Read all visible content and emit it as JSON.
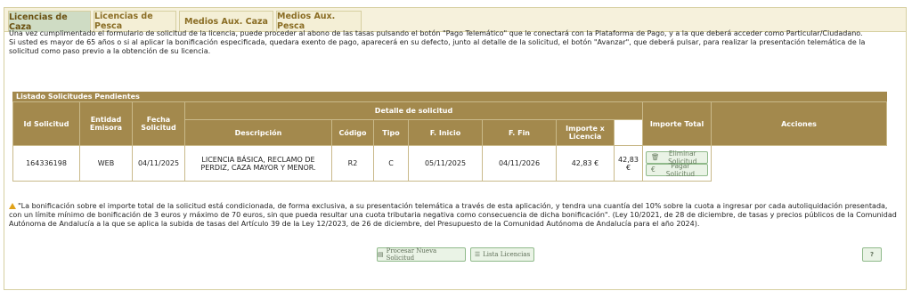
{
  "tabs": [
    {
      "label": "Licencias de Caza",
      "active": true
    },
    {
      "label": "Licencias de Pesca",
      "active": false
    },
    {
      "label": "Medios Aux. Caza",
      "active": false
    },
    {
      "label": "Medios Aux. Pesca",
      "active": false
    }
  ],
  "intro": {
    "line1": "Una vez cumplimentado el formulario de solicitud de la licencia, puede proceder al abono de las tasas pulsando el botón \"Pago Telemático\" que le conectará con la Plataforma de Pago, y a la que deberá acceder como Particular/Ciudadano.",
    "line2": "Si usted es mayor de 65 años o si al aplicar la bonificación especificada, quedara exento de pago, aparecerá en su defecto, junto al detalle de la solicitud, el botón \"Avanzar\", que deberá pulsar, para realizar la presentación telemática de la solicitud como paso previo a la obtención de su licencia."
  },
  "table": {
    "caption": "Listado Solicitudes Pendientes",
    "headers": {
      "id": "Id Solicitud",
      "entidad": "Entidad Emisora",
      "fecha": "Fecha Solicitud",
      "detalle": "Detalle de solicitud",
      "descripcion": "Descripción",
      "codigo": "Código",
      "tipo": "Tipo",
      "inicio": "F. Inicio",
      "fin": "F. Fin",
      "importe_licencia": "Importe x Licencia",
      "importe_total": "Importe Total",
      "acciones": "Acciones"
    },
    "row": {
      "id": "164336198",
      "entidad": "WEB",
      "fecha": "04/11/2025",
      "descripcion": "LICENCIA BÁSICA, RECLAMO DE PERDIZ, CAZA MAYOR Y MENOR.",
      "codigo": "R2",
      "tipo": "C",
      "inicio": "05/11/2025",
      "fin": "04/11/2026",
      "importe_licencia": "42,83 €",
      "importe_total": "42,83 €",
      "eliminar": "Eliminar Solicitud",
      "pagar": "Pagar Solicitud"
    }
  },
  "note": "\"La bonificación sobre el importe total de la solicitud está condicionada, de forma exclusiva, a su presentación telemática a través de esta aplicación, y tendra una cuantía del 10% sobre la cuota a ingresar por cada autoliquidación presentada, con un límite mínimo de bonificación de 3 euros y máximo de 70 euros, sin que pueda resultar una cuota tributaria negativa como consecuencia de dicha bonificación\". (Ley 10/2021, de 28 de diciembre, de tasas y precios públicos de la Comunidad Autónoma de Andalucía a la que se aplica la subida de tasas del Artículo 39 de la Ley 12/2023, de 26 de diciembre, del Presupuesto de la Comunidad Autónoma de Andalucía para el año 2024).",
  "buttons": {
    "procesar": "Procesar Nueva Solicitud",
    "lista": "Lista Licencias",
    "help": "?"
  },
  "colors": {
    "accent": "#a3894d",
    "tab_active": "#cfdcc4",
    "tab_text": "#8a6d24",
    "button_border": "#8fb98a"
  },
  "icons": {
    "trash": "trash-icon",
    "euro": "euro-icon",
    "warning": "warning-icon",
    "document": "document-icon",
    "list": "list-icon"
  }
}
